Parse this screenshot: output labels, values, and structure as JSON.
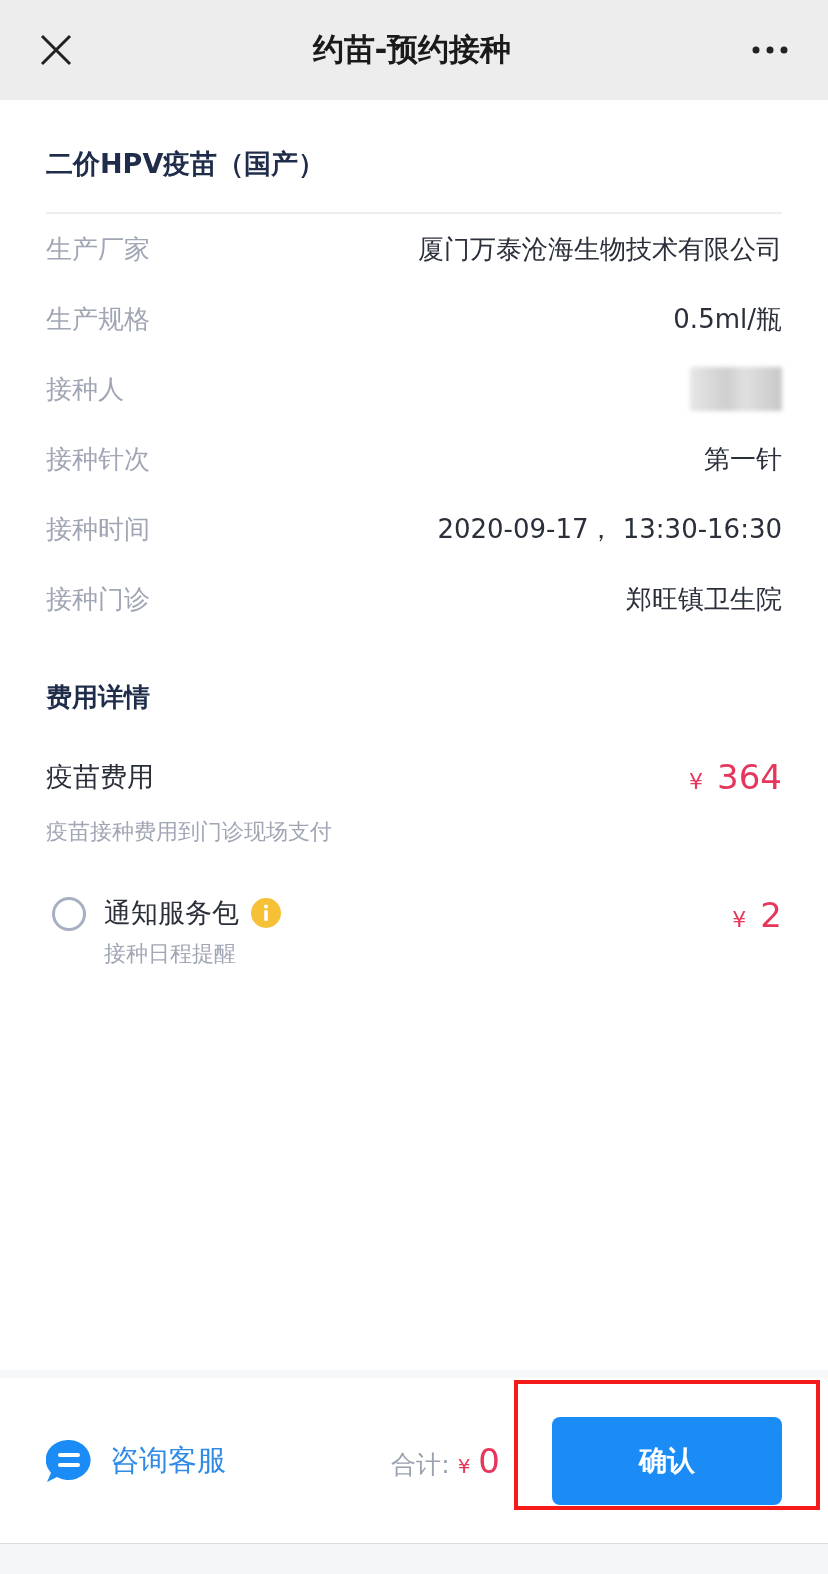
{
  "header": {
    "title": "约苗-预约接种"
  },
  "vaccine": {
    "name": "二价HPV疫苗（国产）",
    "details": [
      {
        "label": "生产厂家",
        "value": "厦门万泰沧海生物技术有限公司",
        "kind": "text"
      },
      {
        "label": "生产规格",
        "value": "0.5ml/瓶",
        "kind": "text"
      },
      {
        "label": "接种人",
        "kind": "redacted"
      },
      {
        "label": "接种针次",
        "value": "第一针",
        "kind": "text"
      },
      {
        "label": "接种时间",
        "value": "2020-09-17， 13:30-16:30",
        "kind": "text"
      },
      {
        "label": "接种门诊",
        "value": "郑旺镇卫生院",
        "kind": "text"
      }
    ]
  },
  "fees": {
    "title": "费用详情",
    "vaccine_fee": {
      "label": "疫苗费用",
      "currency": "¥",
      "amount": "364",
      "note": "疫苗接种费用到门诊现场支付"
    },
    "service": {
      "label": "通知服务包",
      "sub": "接种日程提醒",
      "currency": "¥",
      "amount": "2",
      "checked": false
    }
  },
  "footer": {
    "support": "咨询客服",
    "total_label": "合计:",
    "currency": "¥",
    "total": "0",
    "confirm": "确认",
    "highlighted": true
  }
}
